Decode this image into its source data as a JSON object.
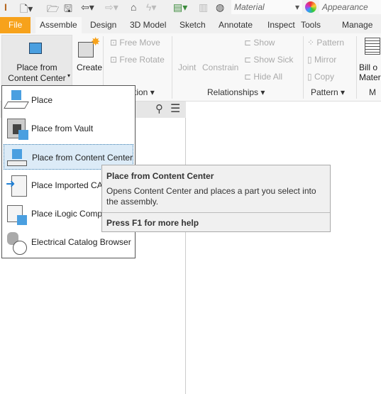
{
  "quick_access": {
    "material": "Material",
    "appearance": "Appearance"
  },
  "tabs": [
    {
      "label": "File"
    },
    {
      "label": "Assemble"
    },
    {
      "label": "Design"
    },
    {
      "label": "3D Model"
    },
    {
      "label": "Sketch"
    },
    {
      "label": "Annotate"
    },
    {
      "label": "Inspect"
    },
    {
      "label": "Tools"
    },
    {
      "label": "Manage"
    }
  ],
  "ribbon": {
    "place_button": "Place from\nContent Center",
    "create": "Create",
    "free_move": "Free Move",
    "free_rotate": "Free Rotate",
    "position_label": "tion",
    "joint": "Joint",
    "constrain": "Constrain",
    "show": "Show",
    "show_sick": "Show Sick",
    "hide_all": "Hide All",
    "relationships_label": "Relationships",
    "pattern": "Pattern",
    "mirror": "Mirror",
    "copy": "Copy",
    "pattern_label": "Pattern",
    "bom": "Bill o\nMater",
    "manage_label": "M"
  },
  "menu": [
    {
      "label": "Place"
    },
    {
      "label": "Place from Vault"
    },
    {
      "label": "Place from Content Center"
    },
    {
      "label": "Place Imported CA"
    },
    {
      "label": "Place iLogic Comp"
    },
    {
      "label": "Electrical  Catalog Browser"
    }
  ],
  "tooltip": {
    "title": "Place from Content Center",
    "description": "Opens Content Center and places a part you select into the assembly.",
    "help": "Press F1 for more help"
  },
  "colors": {
    "file_tab": "#f7a21b",
    "highlight": "#dcebf7",
    "icon_blue": "#4a9fe0"
  }
}
